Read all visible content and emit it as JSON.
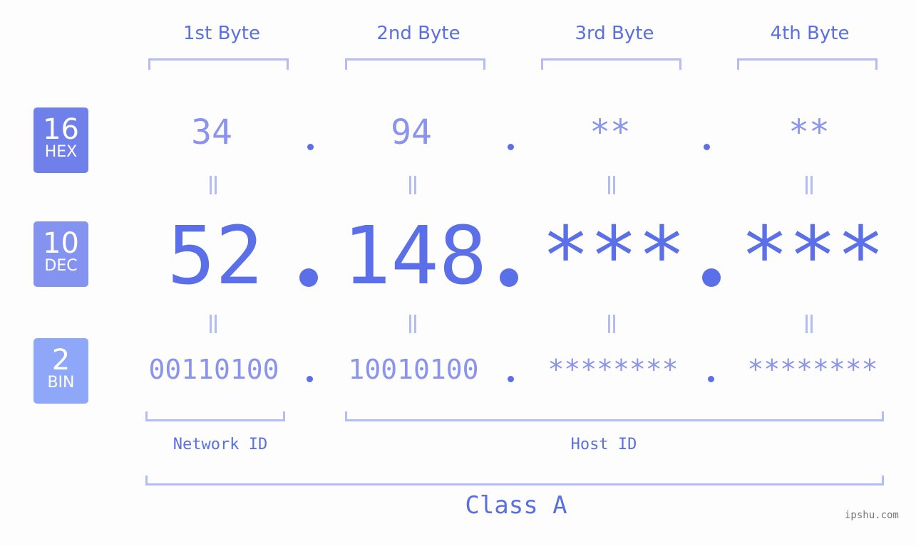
{
  "bases": [
    {
      "num": "16",
      "label": "HEX",
      "color": "#6f80ea"
    },
    {
      "num": "10",
      "label": "DEC",
      "color": "#8593f0"
    },
    {
      "num": "2",
      "label": "BIN",
      "color": "#8ea7f8"
    }
  ],
  "bytes": [
    {
      "header": "1st Byte",
      "hex": "34",
      "dec": "52",
      "bin": "00110100"
    },
    {
      "header": "2nd Byte",
      "hex": "94",
      "dec": "148",
      "bin": "10010100"
    },
    {
      "header": "3rd Byte",
      "hex": "**",
      "dec": "***",
      "bin": "********"
    },
    {
      "header": "4th Byte",
      "hex": "**",
      "dec": "***",
      "bin": "********"
    }
  ],
  "labels": {
    "network_id": "Network ID",
    "host_id": "Host ID",
    "class": "Class A"
  },
  "watermark": "ipshu.com",
  "colors": {
    "accent": "#5a6fe8",
    "light": "#8a93ee",
    "bracket": "#b4bcf8"
  }
}
